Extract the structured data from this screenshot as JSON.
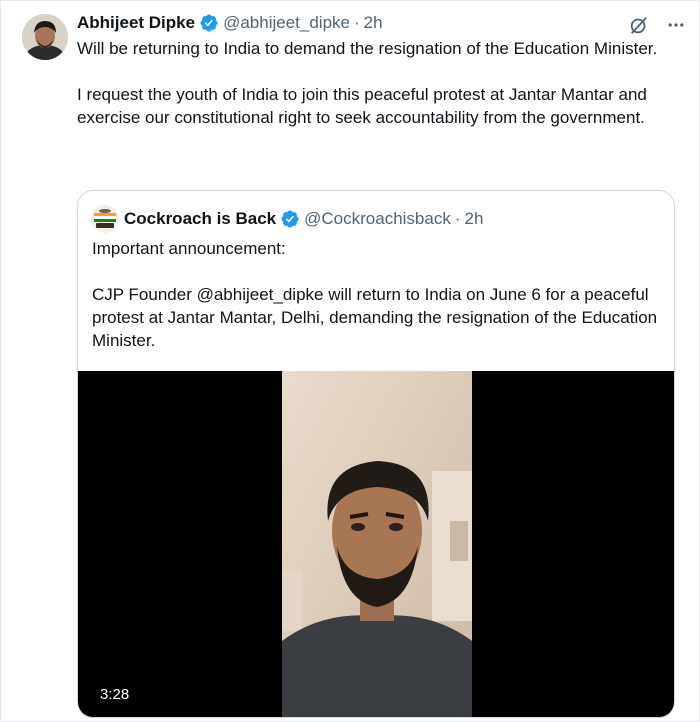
{
  "tweet": {
    "author_name": "Abhijeet Dipke",
    "handle": "@abhijeet_dipke",
    "separator": "·",
    "time": "2h",
    "text": "Will be returning to India to demand the resignation of the Education Minister.\n\nI request the youth of India to join this peaceful protest at Jantar Mantar and exercise our constitutional right to seek accountability from the government."
  },
  "quote": {
    "author_name": "Cockroach is Back",
    "handle": "@Cockroachisback",
    "separator": "·",
    "time": "2h",
    "text": "Important announcement:\n\nCJP Founder @abhijeet_dipke will return to India on June 6 for a peaceful protest at Jantar Mantar, Delhi, demanding the resignation of the Education Minister.",
    "video": {
      "duration": "3:28"
    }
  },
  "icons": {
    "verified": "verified-badge-icon",
    "grok": "grok-icon",
    "more": "more-icon"
  },
  "colors": {
    "verified_blue": "#1d9bf0",
    "secondary_text": "#536471",
    "border": "#cfd9de"
  }
}
